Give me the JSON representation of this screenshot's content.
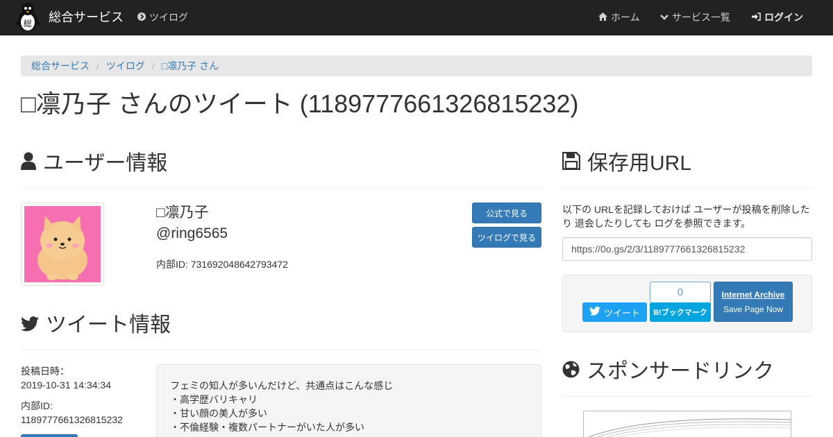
{
  "navbar": {
    "brand": "総合サービス",
    "service_link": "ツイログ",
    "home": "ホーム",
    "services": "サービス一覧",
    "login": "ログイン"
  },
  "breadcrumb": [
    "総合サービス",
    "ツイログ",
    "□凛乃子 さん"
  ],
  "page_title": "□凛乃子 さんのツイート (1189777661326815232)",
  "user_section": {
    "heading": "ユーザー情報",
    "name": "□凛乃子",
    "handle": "@ring6565",
    "internal_id": "内部ID: 731692048642793472",
    "official_button": "公式で見る",
    "twilog_button": "ツイログで見る"
  },
  "tweet_section": {
    "heading": "ツイート情報",
    "posted_label": "投稿日時：",
    "posted_value": "2019-10-31 14:34:34",
    "id_label": "内部ID:",
    "id_value": "1189777661326815232",
    "text_lines": [
      "フェミの知人が多いんだけど、共通点はこんな感じ",
      "・高学歴バリキャリ",
      "・甘い顔の美人が多い",
      "・不倫経験・複数パートナーがいた人が多い"
    ]
  },
  "archive_section": {
    "heading": "保存用URL",
    "description": "以下の URLを記録しておけば ユーザーが投稿を削除したり 退会したりしても ログを参照できます。",
    "url": "https://0o.gs/2/3/1189777661326815232",
    "tweet_button": "ツイート",
    "hatena_count": "0",
    "hatena_button": "B!ブックマーク",
    "ia_title": "Internet Archive",
    "ia_subtitle": "Save Page Now"
  },
  "sponsor_section": {
    "heading": "スポンサードリンク"
  },
  "colors": {
    "navbar": "#222222",
    "link": "#337ab7",
    "button": "#337ab7",
    "twitter": "#1da1f2",
    "hatena": "#00a4de",
    "avatar_bg": "#f66fb0"
  }
}
